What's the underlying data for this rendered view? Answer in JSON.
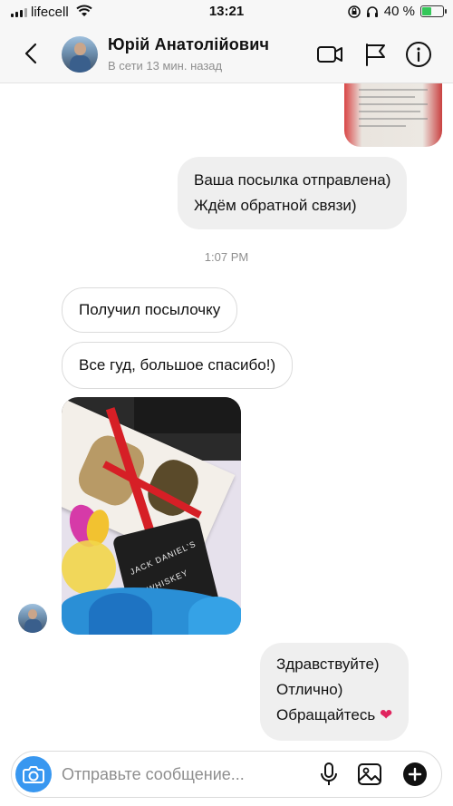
{
  "status_bar": {
    "carrier": "lifecell",
    "time": "13:21",
    "battery": "40 %",
    "battery_level": 0.4
  },
  "header": {
    "contact_name": "Юрій Анатолійович",
    "contact_status": "В сети 13 мин. назад",
    "icons": [
      "back-icon",
      "video-call-icon",
      "flag-icon",
      "info-icon"
    ]
  },
  "messages": {
    "sent_1": [
      "Ваша посылка отправлена)",
      "Ждём обратной связи)"
    ],
    "timestamp": "1:07 PM",
    "received_1": "Получил посылочку",
    "received_2": "Все гуд, большое спасибо!)",
    "sent_2": [
      "Здравствуйте)",
      "Отлично)",
      "Обращайтесь"
    ],
    "sent_2_emoji": "❤"
  },
  "photo": {
    "box_text_1": "JACK DANIEL'S",
    "box_text_2": "WHISKEY"
  },
  "composer": {
    "placeholder": "Отправьте сообщение...",
    "icons": [
      "camera-icon",
      "microphone-icon",
      "gallery-icon",
      "add-icon"
    ]
  },
  "colors": {
    "accent": "#3897f0",
    "bubble_out": "#efefef",
    "heart": "#e0245e"
  }
}
